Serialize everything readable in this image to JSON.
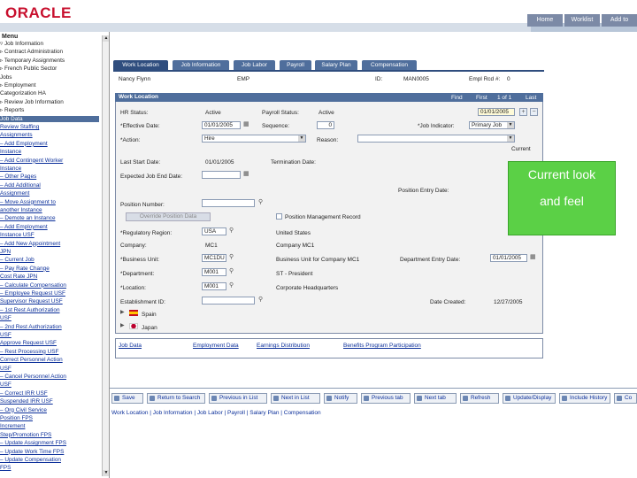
{
  "header": {
    "logo": "ORACLE",
    "nav": [
      "Home",
      "Worklist",
      "Add to"
    ]
  },
  "sidebar": {
    "title": "Menu",
    "items": [
      {
        "label": "▿ Job Information",
        "type": "folder"
      },
      {
        "label": "  ▹ Contract Administration",
        "type": "folder"
      },
      {
        "label": "  ▹ Temporary Assignments",
        "type": "folder"
      },
      {
        "label": "  ▹ French Public Sector",
        "type": "folder"
      },
      {
        "label": "  Jobs",
        "type": "text"
      },
      {
        "label": "  ▹ Employment",
        "type": "folder"
      },
      {
        "label": "  Categorization HA",
        "type": "text"
      },
      {
        "label": "  ▹ Review Job Information",
        "type": "folder"
      },
      {
        "label": "  ▹ Reports",
        "type": "folder"
      },
      {
        "label": "    Job Data",
        "type": "selected"
      },
      {
        "label": "    Review Staffing",
        "type": "link"
      },
      {
        "label": "    Assignments",
        "type": "link"
      },
      {
        "label": "  – Add Employment",
        "type": "link"
      },
      {
        "label": "    Instance",
        "type": "link"
      },
      {
        "label": "  – Add Contingent Worker",
        "type": "link"
      },
      {
        "label": "    Instance",
        "type": "link"
      },
      {
        "label": "  – Other Pages",
        "type": "link"
      },
      {
        "label": "  – Add Additional",
        "type": "link"
      },
      {
        "label": "    Assignment",
        "type": "link"
      },
      {
        "label": "  – Move Assignment to",
        "type": "link"
      },
      {
        "label": "    another Instance",
        "type": "link"
      },
      {
        "label": "  – Demote an Instance",
        "type": "link"
      },
      {
        "label": "  – Add Employment",
        "type": "link"
      },
      {
        "label": "    Instance USF",
        "type": "link"
      },
      {
        "label": "  – Add New Appointment",
        "type": "link"
      },
      {
        "label": "    JPN",
        "type": "link"
      },
      {
        "label": "  – Current Job",
        "type": "link"
      },
      {
        "label": "  – Pay Rate Change",
        "type": "link"
      },
      {
        "label": "    Cost Rate JPN",
        "type": "link"
      },
      {
        "label": "  – Calculate Compensation",
        "type": "link"
      },
      {
        "label": "  – Employee Request USF",
        "type": "link"
      },
      {
        "label": "    Supervisor Request USF",
        "type": "link"
      },
      {
        "label": "  – 1st Rest Authorization",
        "type": "link"
      },
      {
        "label": "    USF",
        "type": "link"
      },
      {
        "label": "  – 2nd Rest Authorization",
        "type": "link"
      },
      {
        "label": "    USF",
        "type": "link"
      },
      {
        "label": "    Approve Request USF",
        "type": "link"
      },
      {
        "label": "  – Rest Processing USF",
        "type": "link"
      },
      {
        "label": "    Correct Personnel Action",
        "type": "link"
      },
      {
        "label": "    USF",
        "type": "link"
      },
      {
        "label": "  – Cancel Personnel Action",
        "type": "link"
      },
      {
        "label": "    USF",
        "type": "link"
      },
      {
        "label": "  – Correct IRR USF",
        "type": "link"
      },
      {
        "label": "    Suspended IRR USF",
        "type": "link"
      },
      {
        "label": "  – Org Civil Service",
        "type": "link"
      },
      {
        "label": "    Position FPS",
        "type": "link"
      },
      {
        "label": "    Increment",
        "type": "link"
      },
      {
        "label": "    Step/Promotion FPS",
        "type": "link"
      },
      {
        "label": "  – Update Assignment FPS",
        "type": "link"
      },
      {
        "label": "  – Update Work Time FPS",
        "type": "link"
      },
      {
        "label": "  – Update Compensation",
        "type": "link"
      },
      {
        "label": "    FPS",
        "type": "link"
      }
    ]
  },
  "tabs": [
    {
      "label": "Work Location",
      "active": true
    },
    {
      "label": "Job Information",
      "active": false
    },
    {
      "label": "Job Labor",
      "active": false
    },
    {
      "label": "Payroll",
      "active": false
    },
    {
      "label": "Salary Plan",
      "active": false
    },
    {
      "label": "Compensation",
      "active": false
    }
  ],
  "person": {
    "name": "Nancy Flynn",
    "type": "EMP",
    "id_label": "ID:",
    "id": "MAN0005",
    "rcd_label": "Empl Rcd #:",
    "rcd": "0"
  },
  "panel": {
    "title": "Work Location",
    "nav": {
      "find": "Find",
      "first": "First",
      "pos": "1 of 1",
      "last": "Last"
    },
    "hr_status_label": "HR Status:",
    "hr_status": "Active",
    "payroll_status_label": "Payroll Status:",
    "payroll_status": "Active",
    "effective_date_label": "*Effective Date:",
    "effective_date": "01/01/2005",
    "sequence_label": "Sequence:",
    "sequence": "0",
    "job_indicator_label": "*Job Indicator:",
    "job_indicator": "Primary Job",
    "action_label": "*Action:",
    "action": "Hire",
    "reason_label": "Reason:",
    "reason": "",
    "current_label": "Current",
    "last_start_label": "Last Start Date:",
    "last_start": "01/01/2005",
    "termination_label": "Termination Date:",
    "expected_end_label": "Expected Job End Date:",
    "position_entry_label": "Position Entry Date:",
    "position_number_label": "Position Number:",
    "override_button": "Override Position Data",
    "position_mgmt_label": "Position Management Record",
    "reg_region_label": "*Regulatory Region:",
    "reg_region": "USA",
    "reg_region_desc": "United States",
    "company_label": "Company:",
    "company": "MC1",
    "company_desc": "Company MC1",
    "business_unit_label": "*Business Unit:",
    "business_unit": "MC1DU",
    "business_unit_desc": "Business Unit for Company MC1",
    "dept_entry_label": "Department Entry Date:",
    "dept_entry": "01/01/2005",
    "department_label": "*Department:",
    "department": "M001",
    "department_desc": "ST - President",
    "location_label": "*Location:",
    "location": "M001",
    "location_desc": "Corporate Headquarters",
    "establishment_label": "Establishment ID:",
    "date_created_label": "Date Created:",
    "date_created": "12/27/2005",
    "country1": "Spain",
    "country2": "Japan"
  },
  "bottom_panel": {
    "links": [
      "Job Data",
      "Employment Data",
      "Earnings Distribution",
      "Benefits Program Participation"
    ]
  },
  "toolbar": [
    {
      "label": "Save"
    },
    {
      "label": "Return to Search"
    },
    {
      "label": "Previous in List"
    },
    {
      "label": "Next in List"
    },
    {
      "label": "Notify"
    },
    {
      "label": "Previous tab"
    },
    {
      "label": "Next tab"
    },
    {
      "label": "Refresh"
    },
    {
      "label": "Update/Display"
    },
    {
      "label": "Include History"
    },
    {
      "label": "Co"
    }
  ],
  "bottom_links": "Work Location | Job Information | Job Labor | Payroll | Salary Plan | Compensation",
  "callout": {
    "line1": "Current look",
    "line2": "and feel"
  },
  "colors": {
    "accent": "#4f6e9c",
    "callout": "#5bd046",
    "logo": "#c8102e"
  }
}
